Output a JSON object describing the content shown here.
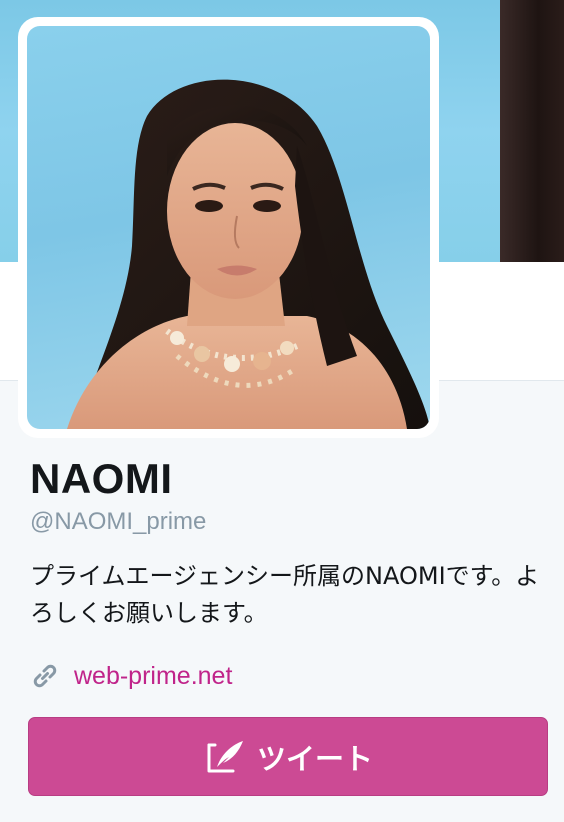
{
  "profile": {
    "name": "NAOMI",
    "handle": "@NAOMI_prime",
    "bio": "プライムエージェンシー所属のNAOMIです。よろしくお願いします。",
    "website": "web-prime.net"
  },
  "actions": {
    "tweet_label": "ツイート"
  },
  "colors": {
    "accent": "#cc4a94",
    "link": "#c0248a",
    "handle": "#8899a6",
    "text": "#14171a",
    "background": "#f5f8fa"
  },
  "icons": {
    "link": "link-icon",
    "tweet": "compose-quill-icon"
  }
}
